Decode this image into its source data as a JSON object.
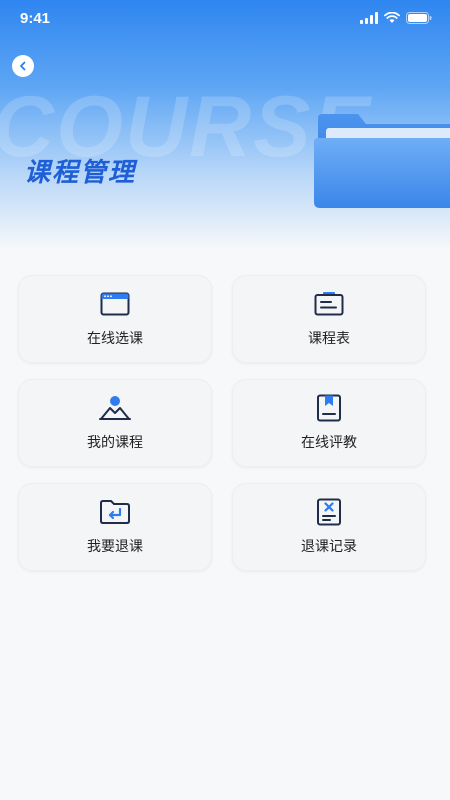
{
  "status_bar": {
    "time": "9:41"
  },
  "header": {
    "watermark": "COURSE",
    "title": "课程管理"
  },
  "menu": [
    {
      "label": "在线选课",
      "icon": "browser-window-icon"
    },
    {
      "label": "课程表",
      "icon": "schedule-board-icon"
    },
    {
      "label": "我的课程",
      "icon": "person-mountain-icon"
    },
    {
      "label": "在线评教",
      "icon": "bookmark-book-icon"
    },
    {
      "label": "我要退课",
      "icon": "folder-return-icon"
    },
    {
      "label": "退课记录",
      "icon": "document-x-icon"
    }
  ],
  "colors": {
    "accent": "#2f7cf0",
    "title": "#1f5fd6",
    "icon_stroke": "#1f2d4a"
  }
}
